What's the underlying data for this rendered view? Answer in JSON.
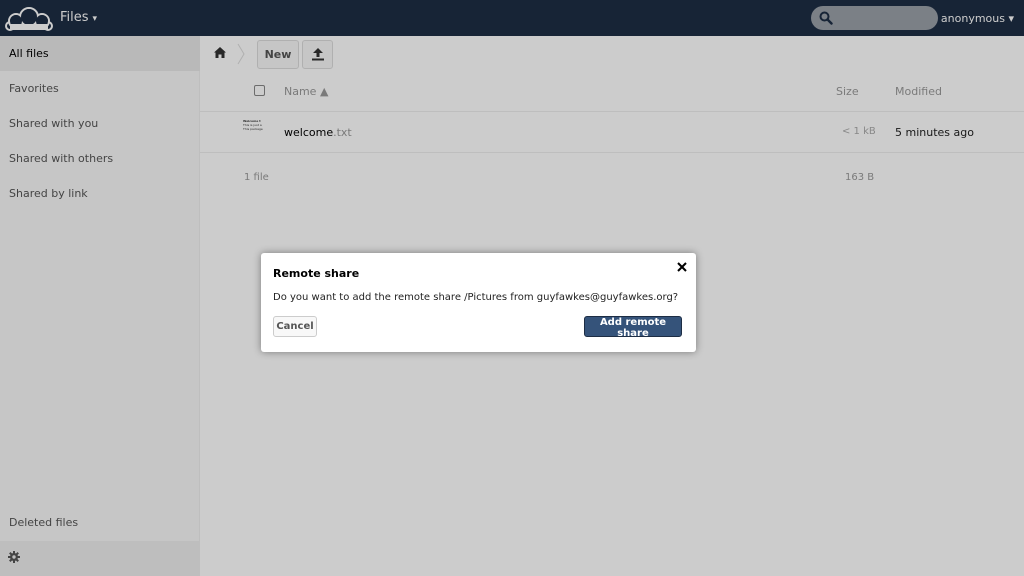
{
  "header": {
    "app_title": "Files",
    "app_caret": "▾",
    "search_placeholder": "",
    "user": "anonymous ▾"
  },
  "sidebar": {
    "items": [
      {
        "label": "All files"
      },
      {
        "label": "Favorites"
      },
      {
        "label": "Shared with you"
      },
      {
        "label": "Shared with others"
      },
      {
        "label": "Shared by link"
      }
    ],
    "deleted": "Deleted files"
  },
  "toolbar": {
    "new_label": "New"
  },
  "table": {
    "col_name": "Name ▲",
    "col_size": "Size",
    "col_modified": "Modified",
    "rows": [
      {
        "name": "welcome",
        "ext": ".txt",
        "size": "< 1 kB",
        "modified": "5 minutes ago",
        "thumb_lines": [
          "Welcome t",
          "This is just a",
          "This package"
        ]
      }
    ],
    "summary_count": "1 file",
    "summary_size": "163 B"
  },
  "dialog": {
    "title": "Remote share",
    "message": "Do you want to add the remote share /Pictures from guyfawkes@guyfawkes.org?",
    "cancel": "Cancel",
    "confirm": "Add remote share"
  },
  "colors": {
    "header_bg": "#1d2d44",
    "primary_button": "#35537a"
  }
}
